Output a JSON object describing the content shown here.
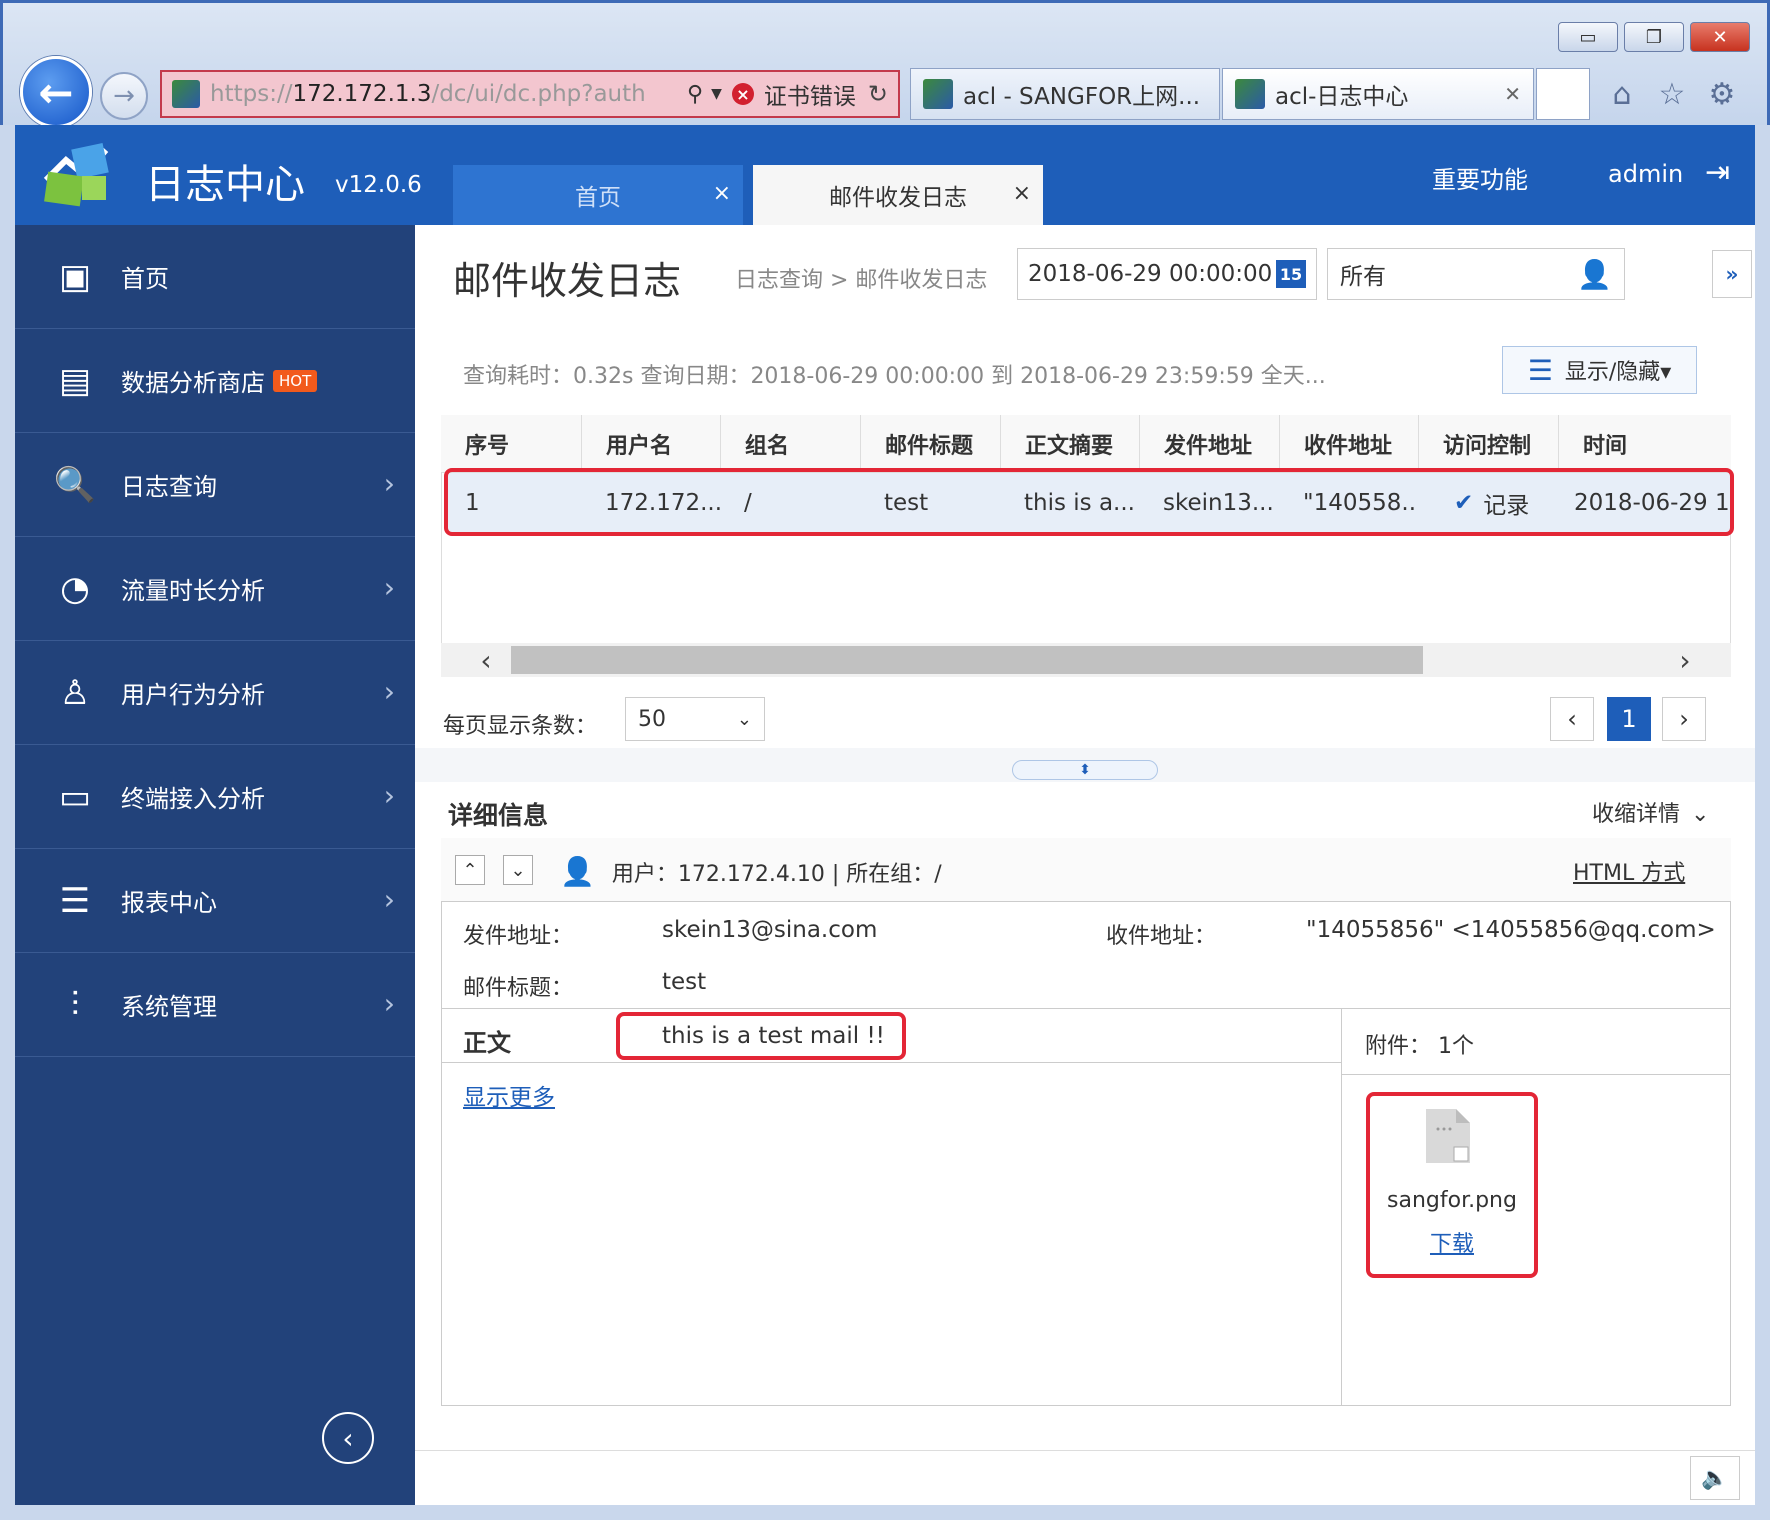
{
  "browser": {
    "window_buttons": {
      "minimize": "▭",
      "restore": "❐",
      "close": "✕"
    },
    "back_icon": "arrow-left-icon",
    "forward_icon": "arrow-right-icon",
    "address_prefix": "https://",
    "address_host": "172.172.1.3",
    "address_rest": "/dc/ui/dc.php?auth",
    "cert_error": "证书错误",
    "tabs": [
      {
        "label": "acl - SANGFOR上网..."
      },
      {
        "label": "acl-日志中心"
      }
    ],
    "tab_close": "✕"
  },
  "header": {
    "app_title": "日志中心",
    "version": "v12.0.6",
    "tabs": [
      {
        "label": "首页"
      },
      {
        "label": "邮件收发日志"
      }
    ],
    "tab_close": "×",
    "important": "重要功能",
    "user": "admin",
    "colors": {
      "brand": "#1e5eb9",
      "sidebar": "#22427a",
      "highlight": "#e32636"
    }
  },
  "sidebar": {
    "items": [
      {
        "label": "首页",
        "icon": "home-card-icon"
      },
      {
        "label": "数据分析商店",
        "icon": "store-icon",
        "badge": "HOT"
      },
      {
        "label": "日志查询",
        "icon": "log-search-icon"
      },
      {
        "label": "流量时长分析",
        "icon": "pie-chart-icon"
      },
      {
        "label": "用户行为分析",
        "icon": "user-icon"
      },
      {
        "label": "终端接入分析",
        "icon": "monitor-icon"
      },
      {
        "label": "报表中心",
        "icon": "report-icon"
      },
      {
        "label": "系统管理",
        "icon": "sliders-icon"
      }
    ]
  },
  "main": {
    "title": "邮件收发日志",
    "breadcrumb": "日志查询 > 邮件收发日志",
    "date_value": "2018-06-29 00:00:00",
    "calendar_day": "15",
    "user_filter": "所有",
    "query_info": "查询耗时：0.32s   查询日期：2018-06-29 00:00:00 到 2018-06-29 23:59:59 全天...",
    "showhide": "显示/隐藏▾",
    "table": {
      "headers": [
        "序号",
        "用户名",
        "组名",
        "邮件标题",
        "正文摘要",
        "发件地址",
        "收件地址",
        "访问控制",
        "时间"
      ],
      "rows": [
        [
          "1",
          "172.172....",
          "/",
          "test",
          "this is a...",
          "skein13...",
          "\"140558...",
          "记录",
          "2018-06-29 1"
        ]
      ]
    },
    "per_page_label": "每页显示条数：",
    "per_page_value": "50",
    "current_page": "1"
  },
  "detail": {
    "title": "详细信息",
    "collapse": "收缩详情",
    "user_info": "用户：172.172.4.10 |  所在组：/",
    "html_mode": "HTML 方式",
    "from_label": "发件地址：",
    "from_value": "skein13@sina.com",
    "to_label": "收件地址：",
    "to_value": "\"14055856\" <14055856@qq.com>",
    "subject_label": "邮件标题：",
    "subject_value": "test",
    "body_label": "正文",
    "body_value": "this is a test mail !!",
    "show_more": "显示更多",
    "attachments_label": "附件： 1个",
    "file_name": "sangfor.png",
    "download": "下载"
  }
}
